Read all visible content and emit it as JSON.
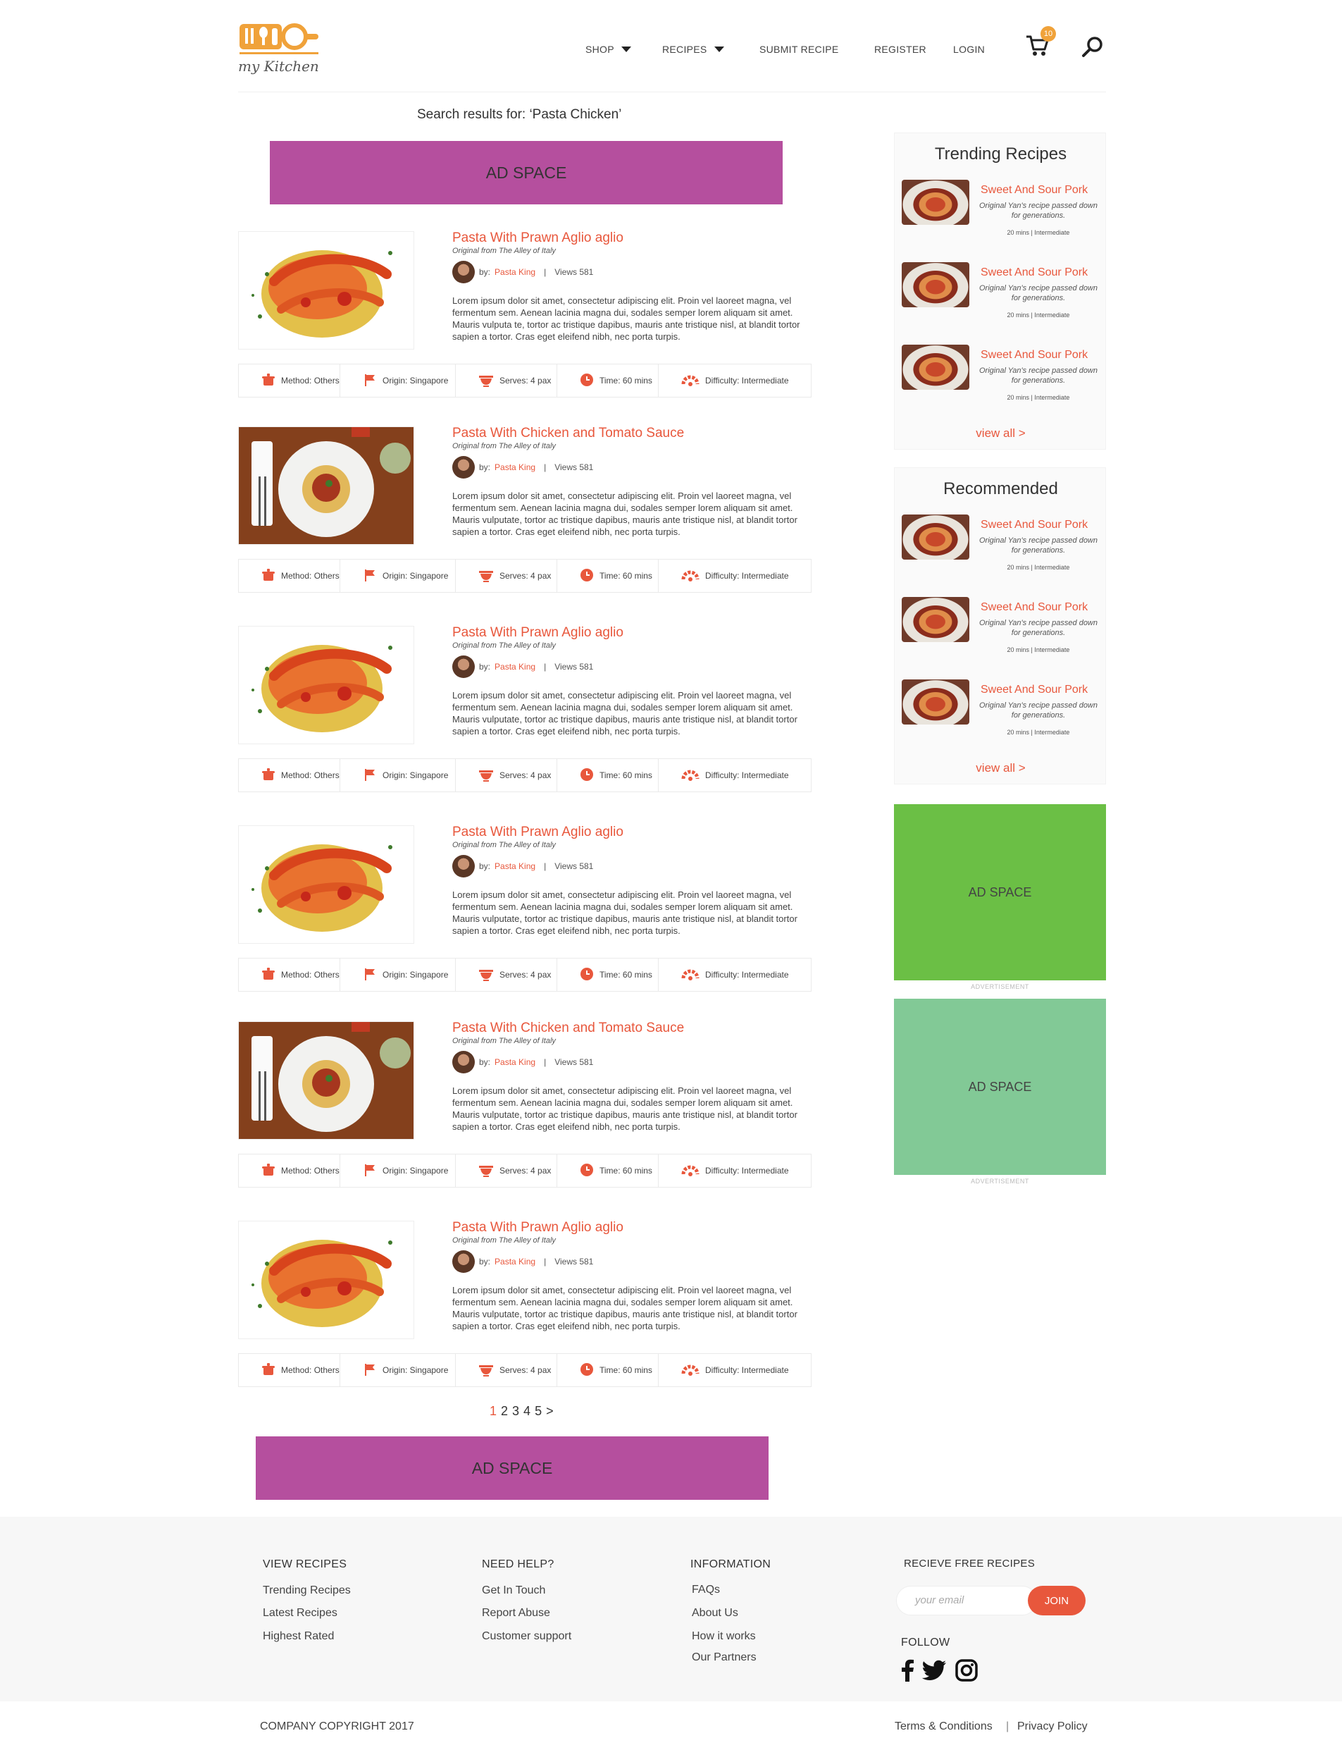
{
  "brand": {
    "logo_text": "my Kitchen",
    "accent": "#e8573c",
    "logo_color": "#f0a23a"
  },
  "nav": {
    "shop": "SHOP",
    "recipes": "RECIPES",
    "submit": "SUBMIT RECIPE",
    "register": "REGISTER",
    "login": "LOGIN",
    "cart_count": "10"
  },
  "search": {
    "results_text": "Search results for: ‘Pasta Chicken’"
  },
  "ads": {
    "top": "AD SPACE",
    "bottom": "AD SPACE",
    "side1": "AD SPACE",
    "side2": "AD SPACE",
    "label": "ADVERTISEMENT"
  },
  "recipes": [
    {
      "title": "Pasta With Prawn Aglio aglio",
      "origin": "Original from The Alley of Italy",
      "by": "by:",
      "author": "Pasta King",
      "views": "Views 581",
      "desc": "Lorem ipsum dolor sit amet, consectetur adipiscing elit. Proin vel laoreet magna, vel fermentum sem. Aenean lacinia magna dui, sodales semper lorem aliquam sit amet. Mauris vulputa te, tortor ac tristique dapibus, mauris ante tristique nisl, at blandit tortor sapien a tortor. Cras eget eleifend nibh, nec porta turpis.",
      "image": "prawn-pasta",
      "method": "Method: Others",
      "origin_meta": "Origin: Singapore",
      "serves": "Serves: 4 pax",
      "time": "Time: 60 mins",
      "difficulty": "Difficulty: Intermediate"
    },
    {
      "title": "Pasta With Chicken and Tomato Sauce",
      "origin": "Original from The Alley of Italy",
      "by": "by:",
      "author": "Pasta King",
      "views": "Views 581",
      "desc": "Lorem ipsum dolor sit amet, consectetur adipiscing elit. Proin vel laoreet magna, vel fermentum sem. Aenean lacinia magna dui, sodales semper lorem aliquam sit amet. Mauris vulputate, tortor ac tristique dapibus, mauris ante tristique nisl, at blandit tortor sapien a tortor. Cras eget eleifend nibh, nec porta turpis.",
      "image": "tomato-pasta",
      "method": "Method: Others",
      "origin_meta": "Origin: Singapore",
      "serves": "Serves: 4 pax",
      "time": "Time: 60 mins",
      "difficulty": "Difficulty: Intermediate"
    },
    {
      "title": "Pasta With Prawn Aglio aglio",
      "origin": "Original from The Alley of Italy",
      "by": "by:",
      "author": "Pasta King",
      "views": "Views 581",
      "desc": "Lorem ipsum dolor sit amet, consectetur adipiscing elit. Proin vel laoreet magna, vel fermentum sem. Aenean lacinia magna dui, sodales semper lorem aliquam sit amet. Mauris vulputate, tortor ac tristique dapibus, mauris ante tristique nisl, at blandit tortor sapien a tortor. Cras eget eleifend nibh, nec porta turpis.",
      "image": "prawn-pasta",
      "method": "Method: Others",
      "origin_meta": "Origin: Singapore",
      "serves": "Serves: 4 pax",
      "time": "Time: 60 mins",
      "difficulty": "Difficulty: Intermediate"
    },
    {
      "title": "Pasta With Prawn Aglio aglio",
      "origin": "Original from The Alley of Italy",
      "by": "by:",
      "author": "Pasta King",
      "views": "Views 581",
      "desc": "Lorem ipsum dolor sit amet, consectetur adipiscing elit. Proin vel laoreet magna, vel fermentum sem. Aenean lacinia magna dui, sodales semper lorem aliquam sit amet. Mauris vulputate, tortor ac tristique dapibus, mauris ante tristique nisl, at blandit tortor sapien a tortor. Cras eget eleifend nibh, nec porta turpis.",
      "image": "prawn-pasta",
      "method": "Method: Others",
      "origin_meta": "Origin: Singapore",
      "serves": "Serves: 4 pax",
      "time": "Time: 60 mins",
      "difficulty": "Difficulty: Intermediate"
    },
    {
      "title": "Pasta With Chicken and Tomato Sauce",
      "origin": "Original from The Alley of Italy",
      "by": "by:",
      "author": "Pasta King",
      "views": "Views 581",
      "desc": "Lorem ipsum dolor sit amet, consectetur adipiscing elit. Proin vel laoreet magna, vel fermentum sem. Aenean lacinia magna dui, sodales semper lorem aliquam sit amet. Mauris vulputate, tortor ac tristique dapibus, mauris ante tristique nisl, at blandit tortor sapien a tortor. Cras eget eleifend nibh, nec porta turpis.",
      "image": "tomato-pasta",
      "method": "Method: Others",
      "origin_meta": "Origin: Singapore",
      "serves": "Serves: 4 pax",
      "time": "Time: 60 mins",
      "difficulty": "Difficulty: Intermediate"
    },
    {
      "title": "Pasta With Prawn Aglio aglio",
      "origin": "Original from The Alley of Italy",
      "by": "by:",
      "author": "Pasta King",
      "views": "Views 581",
      "desc": "Lorem ipsum dolor sit amet, consectetur adipiscing elit. Proin vel laoreet magna, vel fermentum sem. Aenean lacinia magna dui, sodales semper lorem aliquam sit amet. Mauris vulputate, tortor ac tristique dapibus, mauris ante tristique nisl, at blandit tortor sapien a tortor. Cras eget eleifend nibh, nec porta turpis.",
      "image": "prawn-pasta",
      "method": "Method: Others",
      "origin_meta": "Origin: Singapore",
      "serves": "Serves: 4 pax",
      "time": "Time: 60 mins",
      "difficulty": "Difficulty: Intermediate"
    }
  ],
  "pagination": {
    "pages": [
      "1",
      "2",
      "3",
      "4",
      "5"
    ],
    "next": ">",
    "active": "1"
  },
  "sidebar": {
    "trending": {
      "title": "Trending Recipes",
      "items": [
        {
          "name": "Sweet And Sour Pork",
          "desc": "Original Yan's recipe passed down for generations.",
          "meta": "20 mins  |  Intermediate"
        },
        {
          "name": "Sweet And Sour Pork",
          "desc": "Original Yan's recipe passed down for generations.",
          "meta": "20 mins  |  Intermediate"
        },
        {
          "name": "Sweet And Sour Pork",
          "desc": "Original Yan's recipe passed down for generations.",
          "meta": "20 mins  |  Intermediate"
        }
      ],
      "view_all": "view all >"
    },
    "recommended": {
      "title": "Recommended",
      "items": [
        {
          "name": "Sweet And Sour Pork",
          "desc": "Original Yan's recipe passed down for generations.",
          "meta": "20 mins  |  Intermediate"
        },
        {
          "name": "Sweet And Sour Pork",
          "desc": "Original Yan's recipe passed down for generations.",
          "meta": "20 mins  |  Intermediate"
        },
        {
          "name": "Sweet And Sour Pork",
          "desc": "Original Yan's recipe passed down for generations.",
          "meta": "20 mins  |  Intermediate"
        }
      ],
      "view_all": "view all >"
    }
  },
  "footer": {
    "view_recipes": {
      "title": "VIEW RECIPES",
      "links": [
        "Trending Recipes",
        "Latest Recipes",
        "Highest Rated"
      ]
    },
    "need_help": {
      "title": "NEED HELP?",
      "links": [
        "Get In Touch",
        "Report Abuse",
        "Customer support"
      ]
    },
    "information": {
      "title": "INFORMATION",
      "links": [
        "FAQs",
        "About Us",
        "How it works",
        "Our Partners"
      ]
    },
    "newsletter": {
      "title": "RECIEVE FREE RECIPES",
      "placeholder": "your email",
      "join": "JOIN"
    },
    "follow": {
      "title": "FOLLOW",
      "icons": [
        "facebook-icon",
        "twitter-icon",
        "instagram-icon"
      ]
    },
    "copyright": "COMPANY COPYRIGHT 2017",
    "terms": "Terms & Conditions",
    "separator": "|",
    "privacy": "Privacy Policy"
  }
}
